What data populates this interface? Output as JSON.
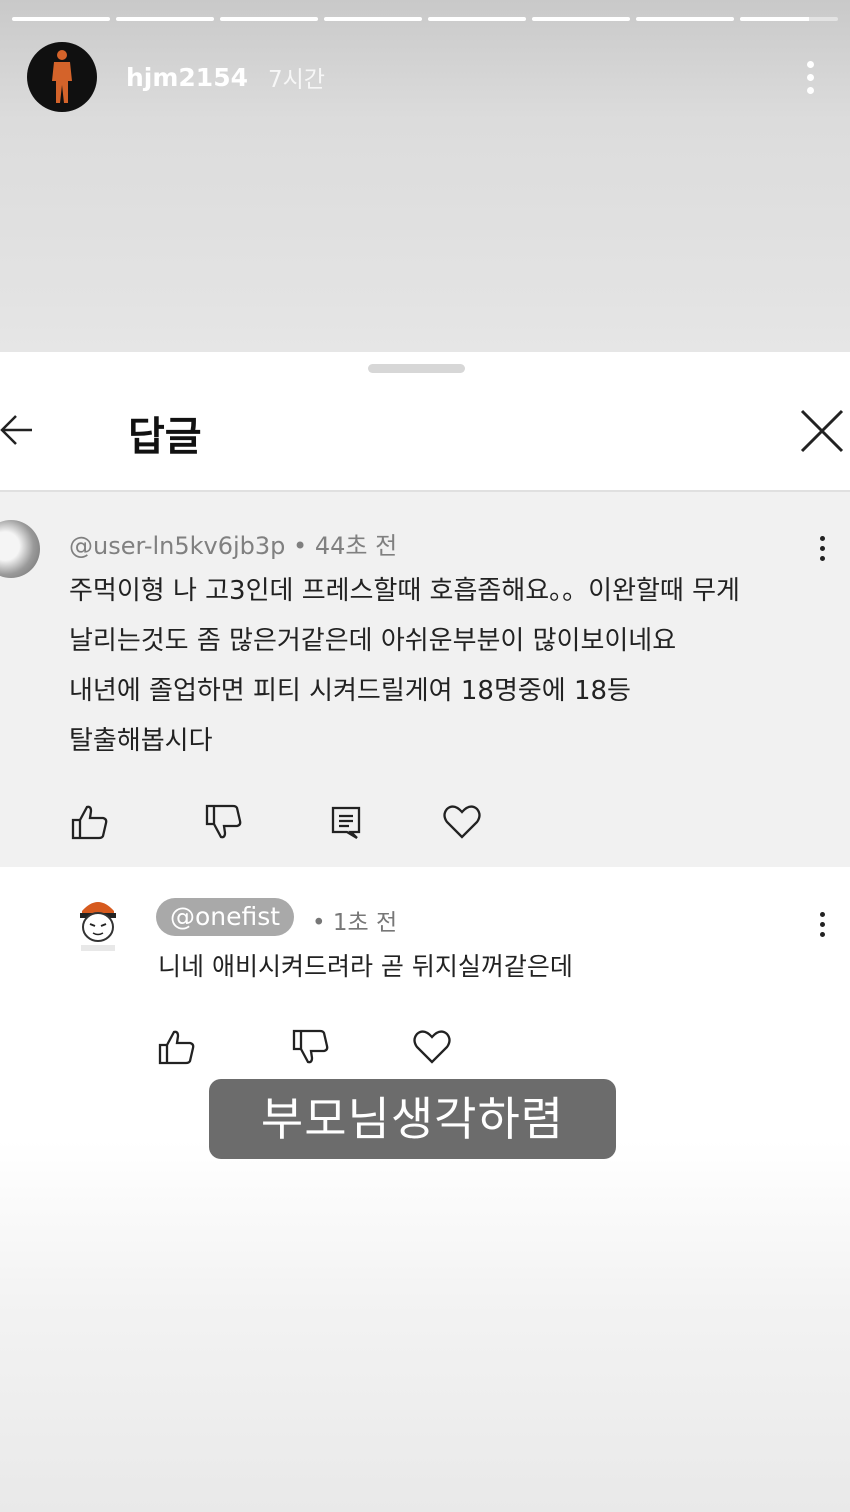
{
  "story": {
    "progress": [
      1,
      1,
      1,
      1,
      1,
      1,
      1,
      0.7
    ],
    "username": "hjm2154",
    "time_ago": "7시간",
    "more_icon": "more-vertical-icon"
  },
  "sheet": {
    "title": "답글",
    "back_icon": "arrow-left-icon",
    "close_icon": "close-icon"
  },
  "comment": {
    "handle": "@user-ln5kv6jb3p",
    "time": "44초 전",
    "meta_separator": "•",
    "lines": [
      "주먹이형 나 고3인데 프레스할때 호흡좀해요。。이완할때 무게",
      "날리는것도 좀 많은거같은데 아쉬운부분이 많이보이네요",
      "내년에 졸업하면 피티 시켜드릴게여 18명중에 18등",
      "탈출해봅시다"
    ],
    "actions": [
      "like-icon",
      "dislike-icon",
      "reply-icon",
      "heart-icon"
    ]
  },
  "reply": {
    "handle": "@onefist",
    "separator": "•",
    "time": "1초 전",
    "text": "니네 애비시켜드려라 곧 뒤지실꺼같은데",
    "actions": [
      "like-icon",
      "dislike-icon",
      "heart-icon"
    ]
  },
  "caption": "부모님생각하렴",
  "colors": {
    "caption_bg": "#5f5f5f",
    "handle_pill": "#a9a9a9",
    "comment_bg": "#f1f1f1"
  }
}
